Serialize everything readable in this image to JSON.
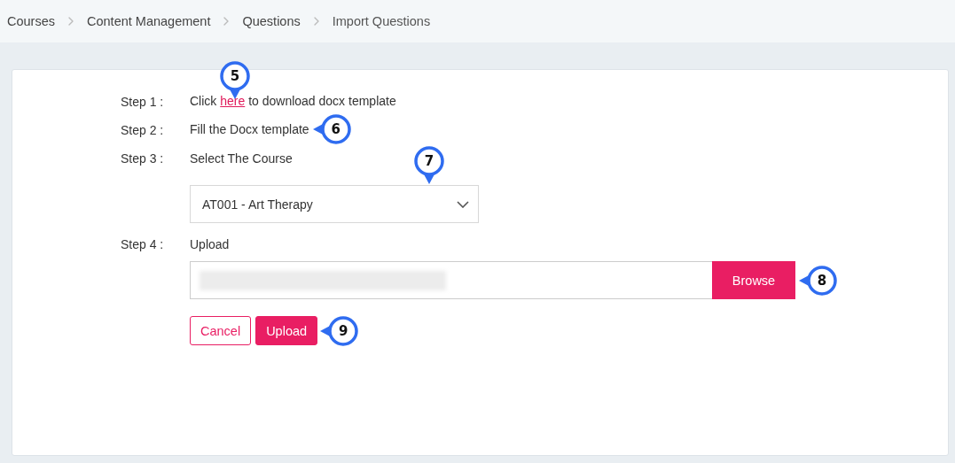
{
  "breadcrumb": [
    {
      "label": "Courses",
      "selected": false
    },
    {
      "label": "Content Management",
      "selected": false
    },
    {
      "label": "Questions",
      "selected": false
    },
    {
      "label": "Import Questions",
      "selected": true
    }
  ],
  "steps": [
    {
      "kind": "link",
      "label": "Step 1 :",
      "before": "Click ",
      "link": "here",
      "after": " to download docx template",
      "callout": "5"
    },
    {
      "kind": "text",
      "label": "Step 2 :",
      "text": "Fill the Docx template",
      "callout": "6"
    },
    {
      "kind": "select",
      "label": "Step 3 :",
      "text": "Select The Course",
      "value": "AT001 - Art Therapy",
      "callout": "7"
    },
    {
      "kind": "upload",
      "label": "Step 4 :",
      "text": "Upload",
      "browse": "Browse",
      "callout": "8"
    }
  ],
  "actions": [
    {
      "label": "Cancel",
      "kind": "outline"
    },
    {
      "label": "Upload",
      "kind": "primary",
      "callout": "9"
    }
  ]
}
